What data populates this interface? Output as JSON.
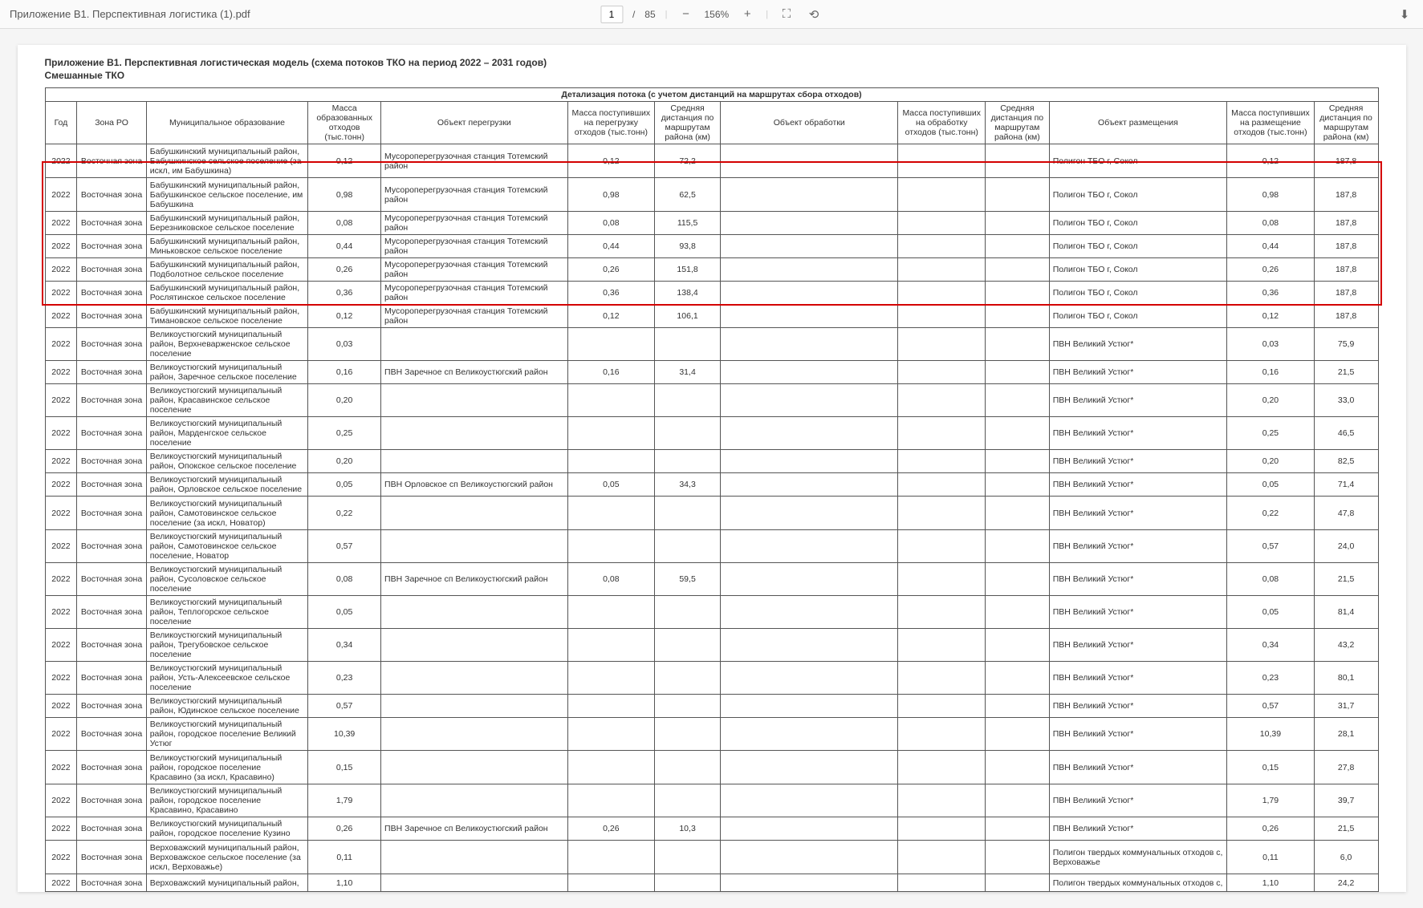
{
  "toolbar": {
    "file_title": "Приложение В1. Перспективная логистика (1).pdf",
    "page_current": "1",
    "page_sep": "/",
    "page_total": "85",
    "zoom_value": "156%"
  },
  "doc": {
    "title": "Приложение В1. Перспективная логистическая модель (схема потоков ТКО на период 2022 – 2031 годов)",
    "subtitle": "Смешанные ТКО"
  },
  "table": {
    "caption": "Детализация потока (с учетом дистанций на маршрутах сбора отходов)",
    "headers": {
      "year": "Год",
      "zone": "Зона РО",
      "municipality": "Муниципальное образование",
      "mass_form": "Масса образованных отходов (тыс.тонн)",
      "obj_transfer": "Объект перегрузки",
      "mass_transfer": "Масса поступивших на перегрузку отходов (тыс.тонн)",
      "dist_transfer": "Средняя дистанция по маршрутам района (км)",
      "obj_proc": "Объект обработки",
      "mass_proc": "Масса поступивших на обработку отходов (тыс.тонн)",
      "dist_proc": "Средняя дистанция по маршрутам района (км)",
      "obj_place": "Объект размещения",
      "mass_place": "Масса поступивших на размещение отходов (тыс.тонн)",
      "dist_place": "Средняя дистанция по маршрутам района (км)"
    },
    "rows": [
      {
        "year": "2022",
        "zone": "Восточная зона",
        "mun": "Бабушкинский муниципальный район, Бабушкинское сельское поселение (за искл, им Бабушкина)",
        "m1": "0,12",
        "o1": "Мусороперегрузочная станция Тотемский район",
        "m2": "0,12",
        "d1": "72,2",
        "o2": "",
        "m3": "",
        "d2": "",
        "o3": "Полигон ТБО г, Сокол",
        "m4": "0,12",
        "d3": "187,8",
        "cls": "vtall"
      },
      {
        "year": "2022",
        "zone": "Восточная зона",
        "mun": "Бабушкинский муниципальный район, Бабушкинское сельское поселение, им Бабушкина",
        "m1": "0,98",
        "o1": "Мусороперегрузочная станция Тотемский район",
        "m2": "0,98",
        "d1": "62,5",
        "o2": "",
        "m3": "",
        "d2": "",
        "o3": "Полигон ТБО г, Сокол",
        "m4": "0,98",
        "d3": "187,8",
        "cls": "vtall"
      },
      {
        "year": "2022",
        "zone": "Восточная зона",
        "mun": "Бабушкинский муниципальный район, Березниковское сельское поселение",
        "m1": "0,08",
        "o1": "Мусороперегрузочная станция Тотемский район",
        "m2": "0,08",
        "d1": "115,5",
        "o2": "",
        "m3": "",
        "d2": "",
        "o3": "Полигон ТБО г, Сокол",
        "m4": "0,08",
        "d3": "187,8",
        "cls": ""
      },
      {
        "year": "2022",
        "zone": "Восточная зона",
        "mun": "Бабушкинский муниципальный район, Миньковское сельское поселение",
        "m1": "0,44",
        "o1": "Мусороперегрузочная станция Тотемский район",
        "m2": "0,44",
        "d1": "93,8",
        "o2": "",
        "m3": "",
        "d2": "",
        "o3": "Полигон ТБО г, Сокол",
        "m4": "0,44",
        "d3": "187,8",
        "cls": ""
      },
      {
        "year": "2022",
        "zone": "Восточная зона",
        "mun": "Бабушкинский муниципальный район, Подболотное сельское поселение",
        "m1": "0,26",
        "o1": "Мусороперегрузочная станция Тотемский район",
        "m2": "0,26",
        "d1": "151,8",
        "o2": "",
        "m3": "",
        "d2": "",
        "o3": "Полигон ТБО г, Сокол",
        "m4": "0,26",
        "d3": "187,8",
        "cls": ""
      },
      {
        "year": "2022",
        "zone": "Восточная зона",
        "mun": "Бабушкинский муниципальный район, Рослятинское сельское поселение",
        "m1": "0,36",
        "o1": "Мусороперегрузочная станция Тотемский район",
        "m2": "0,36",
        "d1": "138,4",
        "o2": "",
        "m3": "",
        "d2": "",
        "o3": "Полигон ТБО г, Сокол",
        "m4": "0,36",
        "d3": "187,8",
        "cls": ""
      },
      {
        "year": "2022",
        "zone": "Восточная зона",
        "mun": "Бабушкинский муниципальный район, Тимановское сельское поселение",
        "m1": "0,12",
        "o1": "Мусороперегрузочная станция Тотемский район",
        "m2": "0,12",
        "d1": "106,1",
        "o2": "",
        "m3": "",
        "d2": "",
        "o3": "Полигон ТБО г, Сокол",
        "m4": "0,12",
        "d3": "187,8",
        "cls": ""
      },
      {
        "year": "2022",
        "zone": "Восточная зона",
        "mun": "Великоустюгский муниципальный район, Верхневарженское сельское поселение",
        "m1": "0,03",
        "o1": "",
        "m2": "",
        "d1": "",
        "o2": "",
        "m3": "",
        "d2": "",
        "o3": "ПВН Великий Устюг*",
        "m4": "0,03",
        "d3": "75,9",
        "cls": ""
      },
      {
        "year": "2022",
        "zone": "Восточная зона",
        "mun": "Великоустюгский муниципальный район, Заречное сельское поселение",
        "m1": "0,16",
        "o1": "ПВН Заречное сп Великоустюгский район",
        "m2": "0,16",
        "d1": "31,4",
        "o2": "",
        "m3": "",
        "d2": "",
        "o3": "ПВН Великий Устюг*",
        "m4": "0,16",
        "d3": "21,5",
        "cls": ""
      },
      {
        "year": "2022",
        "zone": "Восточная зона",
        "mun": "Великоустюгский муниципальный район, Красавинское сельское поселение",
        "m1": "0,20",
        "o1": "",
        "m2": "",
        "d1": "",
        "o2": "",
        "m3": "",
        "d2": "",
        "o3": "ПВН Великий Устюг*",
        "m4": "0,20",
        "d3": "33,0",
        "cls": ""
      },
      {
        "year": "2022",
        "zone": "Восточная зона",
        "mun": "Великоустюгский муниципальный район, Марденгское сельское поселение",
        "m1": "0,25",
        "o1": "",
        "m2": "",
        "d1": "",
        "o2": "",
        "m3": "",
        "d2": "",
        "o3": "ПВН Великий Устюг*",
        "m4": "0,25",
        "d3": "46,5",
        "cls": ""
      },
      {
        "year": "2022",
        "zone": "Восточная зона",
        "mun": "Великоустюгский муниципальный район, Опокское сельское поселение",
        "m1": "0,20",
        "o1": "",
        "m2": "",
        "d1": "",
        "o2": "",
        "m3": "",
        "d2": "",
        "o3": "ПВН Великий Устюг*",
        "m4": "0,20",
        "d3": "82,5",
        "cls": ""
      },
      {
        "year": "2022",
        "zone": "Восточная зона",
        "mun": "Великоустюгский муниципальный район, Орловское сельское поселение",
        "m1": "0,05",
        "o1": "ПВН Орловское сп Великоустюгский район",
        "m2": "0,05",
        "d1": "34,3",
        "o2": "",
        "m3": "",
        "d2": "",
        "o3": "ПВН Великий Устюг*",
        "m4": "0,05",
        "d3": "71,4",
        "cls": ""
      },
      {
        "year": "2022",
        "zone": "Восточная зона",
        "mun": "Великоустюгский муниципальный район, Самотовинское сельское поселение (за искл, Новатор)",
        "m1": "0,22",
        "o1": "",
        "m2": "",
        "d1": "",
        "o2": "",
        "m3": "",
        "d2": "",
        "o3": "ПВН Великий Устюг*",
        "m4": "0,22",
        "d3": "47,8",
        "cls": "vtall"
      },
      {
        "year": "2022",
        "zone": "Восточная зона",
        "mun": "Великоустюгский муниципальный район, Самотовинское сельское поселение, Новатор",
        "m1": "0,57",
        "o1": "",
        "m2": "",
        "d1": "",
        "o2": "",
        "m3": "",
        "d2": "",
        "o3": "ПВН Великий Устюг*",
        "m4": "0,57",
        "d3": "24,0",
        "cls": "tall"
      },
      {
        "year": "2022",
        "zone": "Восточная зона",
        "mun": "Великоустюгский муниципальный район, Сусоловское сельское поселение",
        "m1": "0,08",
        "o1": "ПВН Заречное сп Великоустюгский район",
        "m2": "0,08",
        "d1": "59,5",
        "o2": "",
        "m3": "",
        "d2": "",
        "o3": "ПВН Великий Устюг*",
        "m4": "0,08",
        "d3": "21,5",
        "cls": ""
      },
      {
        "year": "2022",
        "zone": "Восточная зона",
        "mun": "Великоустюгский муниципальный район, Теплогорское сельское поселение",
        "m1": "0,05",
        "o1": "",
        "m2": "",
        "d1": "",
        "o2": "",
        "m3": "",
        "d2": "",
        "o3": "ПВН Великий Устюг*",
        "m4": "0,05",
        "d3": "81,4",
        "cls": ""
      },
      {
        "year": "2022",
        "zone": "Восточная зона",
        "mun": "Великоустюгский муниципальный район, Трегубовское сельское поселение",
        "m1": "0,34",
        "o1": "",
        "m2": "",
        "d1": "",
        "o2": "",
        "m3": "",
        "d2": "",
        "o3": "ПВН Великий Устюг*",
        "m4": "0,34",
        "d3": "43,2",
        "cls": ""
      },
      {
        "year": "2022",
        "zone": "Восточная зона",
        "mun": "Великоустюгский муниципальный район, Усть-Алексеевское сельское поселение",
        "m1": "0,23",
        "o1": "",
        "m2": "",
        "d1": "",
        "o2": "",
        "m3": "",
        "d2": "",
        "o3": "ПВН Великий Устюг*",
        "m4": "0,23",
        "d3": "80,1",
        "cls": ""
      },
      {
        "year": "2022",
        "zone": "Восточная зона",
        "mun": "Великоустюгский муниципальный район, Юдинское сельское поселение",
        "m1": "0,57",
        "o1": "",
        "m2": "",
        "d1": "",
        "o2": "",
        "m3": "",
        "d2": "",
        "o3": "ПВН Великий Устюг*",
        "m4": "0,57",
        "d3": "31,7",
        "cls": ""
      },
      {
        "year": "2022",
        "zone": "Восточная зона",
        "mun": "Великоустюгский муниципальный район, городское поселение Великий Устюг",
        "m1": "10,39",
        "o1": "",
        "m2": "",
        "d1": "",
        "o2": "",
        "m3": "",
        "d2": "",
        "o3": "ПВН Великий Устюг*",
        "m4": "10,39",
        "d3": "28,1",
        "cls": ""
      },
      {
        "year": "2022",
        "zone": "Восточная зона",
        "mun": "Великоустюгский муниципальный район, городское поселение Красавино (за искл, Красавино)",
        "m1": "0,15",
        "o1": "",
        "m2": "",
        "d1": "",
        "o2": "",
        "m3": "",
        "d2": "",
        "o3": "ПВН Великий Устюг*",
        "m4": "0,15",
        "d3": "27,8",
        "cls": "vtall"
      },
      {
        "year": "2022",
        "zone": "Восточная зона",
        "mun": "Великоустюгский муниципальный район, городское поселение Красавино, Красавино",
        "m1": "1,79",
        "o1": "",
        "m2": "",
        "d1": "",
        "o2": "",
        "m3": "",
        "d2": "",
        "o3": "ПВН Великий Устюг*",
        "m4": "1,79",
        "d3": "39,7",
        "cls": ""
      },
      {
        "year": "2022",
        "zone": "Восточная зона",
        "mun": "Великоустюгский муниципальный район, городское поселение Кузино",
        "m1": "0,26",
        "o1": "ПВН Заречное сп Великоустюгский район",
        "m2": "0,26",
        "d1": "10,3",
        "o2": "",
        "m3": "",
        "d2": "",
        "o3": "ПВН Великий Устюг*",
        "m4": "0,26",
        "d3": "21,5",
        "cls": ""
      },
      {
        "year": "2022",
        "zone": "Восточная зона",
        "mun": "Верховажский муниципальный район, Верховажское сельское поселение (за искл, Верховажье)",
        "m1": "0,11",
        "o1": "",
        "m2": "",
        "d1": "",
        "o2": "",
        "m3": "",
        "d2": "",
        "o3": "Полигон твердых коммунальных отходов с, Верховажье",
        "m4": "0,11",
        "d3": "6,0",
        "cls": "vtall"
      },
      {
        "year": "2022",
        "zone": "Восточная зона",
        "mun": "Верховажский муниципальный район,",
        "m1": "1,10",
        "o1": "",
        "m2": "",
        "d1": "",
        "o2": "",
        "m3": "",
        "d2": "",
        "o3": "Полигон твердых коммунальных отходов с,",
        "m4": "1,10",
        "d3": "24,2",
        "cls": ""
      }
    ]
  }
}
